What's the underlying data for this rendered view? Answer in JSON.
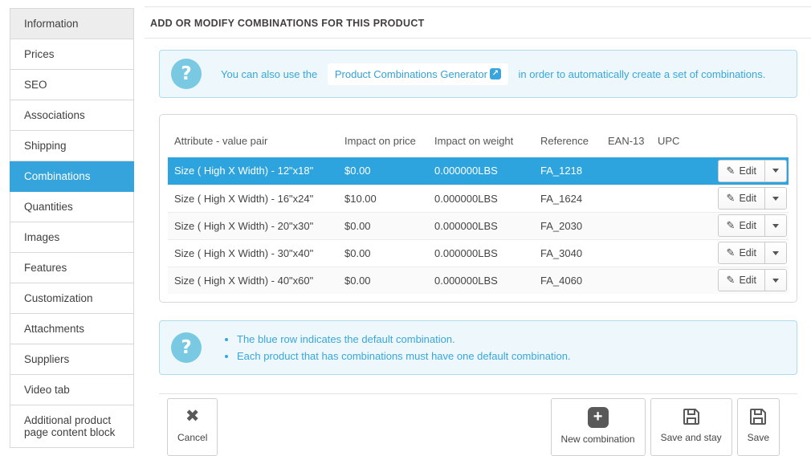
{
  "sidebar": {
    "items": [
      {
        "label": "Information"
      },
      {
        "label": "Prices"
      },
      {
        "label": "SEO"
      },
      {
        "label": "Associations"
      },
      {
        "label": "Shipping"
      },
      {
        "label": "Combinations",
        "active": true
      },
      {
        "label": "Quantities"
      },
      {
        "label": "Images"
      },
      {
        "label": "Features"
      },
      {
        "label": "Customization"
      },
      {
        "label": "Attachments"
      },
      {
        "label": "Suppliers"
      },
      {
        "label": "Video tab"
      },
      {
        "label": "Additional product page content block"
      }
    ]
  },
  "header": {
    "title": "ADD OR MODIFY COMBINATIONS FOR THIS PRODUCT"
  },
  "generator_alert": {
    "text_before": "You can also use the",
    "link_label": "Product Combinations Generator",
    "text_after": "in order to automatically create a set of combinations."
  },
  "table": {
    "columns": [
      "Attribute - value pair",
      "Impact on price",
      "Impact on weight",
      "Reference",
      "EAN-13",
      "UPC"
    ],
    "edit_label": "Edit",
    "rows": [
      {
        "attribute": "Size ( High X Width) - 12\"x18\"",
        "price": "$0.00",
        "weight": "0.000000LBS",
        "reference": "FA_1218",
        "ean13": "",
        "upc": "",
        "default": true
      },
      {
        "attribute": "Size ( High X Width) - 16\"x24\"",
        "price": "$10.00",
        "weight": "0.000000LBS",
        "reference": "FA_1624",
        "ean13": "",
        "upc": "",
        "default": false
      },
      {
        "attribute": "Size ( High X Width) - 20\"x30\"",
        "price": "$0.00",
        "weight": "0.000000LBS",
        "reference": "FA_2030",
        "ean13": "",
        "upc": "",
        "default": false
      },
      {
        "attribute": "Size ( High X Width) - 30\"x40\"",
        "price": "$0.00",
        "weight": "0.000000LBS",
        "reference": "FA_3040",
        "ean13": "",
        "upc": "",
        "default": false
      },
      {
        "attribute": "Size ( High X Width) - 40\"x60\"",
        "price": "$0.00",
        "weight": "0.000000LBS",
        "reference": "FA_4060",
        "ean13": "",
        "upc": "",
        "default": false
      }
    ]
  },
  "info_alert": {
    "bullets": [
      "The blue row indicates the default combination.",
      "Each product that has combinations must have one default combination."
    ]
  },
  "footer": {
    "cancel_label": "Cancel",
    "new_combination_label": "New combination",
    "save_and_stay_label": "Save and stay",
    "save_label": "Save"
  },
  "icons": {
    "help": "?",
    "external_link": "↗",
    "pencil": "✎",
    "cancel_x": "✖",
    "plus": "+"
  },
  "colors": {
    "accent_blue": "#2ea4de",
    "sidebar_active_blue": "#35a4dc",
    "alert_text_blue": "#38a6da",
    "alert_background": "#eef8fc",
    "alert_border": "#aedcec",
    "help_icon_blue": "#79c9e3"
  }
}
